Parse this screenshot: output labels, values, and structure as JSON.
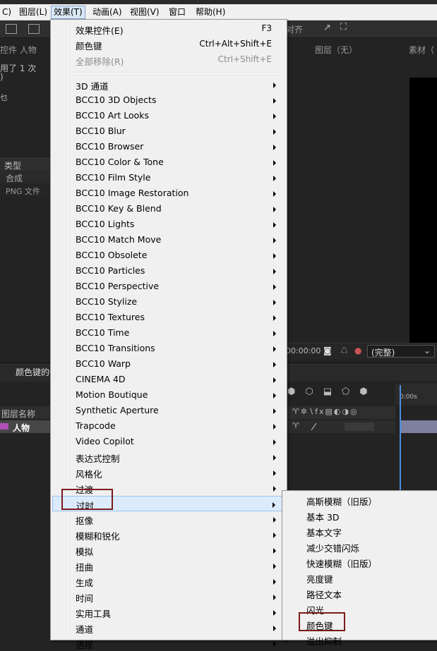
{
  "menubar": {
    "items": [
      {
        "label": "C)"
      },
      {
        "label": "图层(L)"
      },
      {
        "label": "效果(T)"
      },
      {
        "label": "动画(A)"
      },
      {
        "label": "视图(V)"
      },
      {
        "label": "窗口"
      },
      {
        "label": "帮助(H)"
      }
    ]
  },
  "toolbar": {
    "align_label": "对齐"
  },
  "project_panel": {
    "tab_label": "控件 人物",
    "used_text": "用了 1 次",
    "paren_text": ")",
    "small_text": "乜",
    "type_header": "类型",
    "rows": [
      "合成",
      "PNG 文件"
    ]
  },
  "composition": {
    "tab_label": "图层（无）",
    "footage_label": "素材（",
    "timecode": "00:00:00",
    "quality": "(完整)",
    "frame_label": "0:00s"
  },
  "timeline": {
    "comp_tab": "颜色键的使",
    "layer_name_header": "图层名称",
    "layer_name": "人物"
  },
  "effects_menu": {
    "items": [
      {
        "label": "效果控件(E)",
        "shortcut": "F3",
        "arrow": false,
        "disabled": false
      },
      {
        "label": "颜色键",
        "shortcut": "Ctrl+Alt+Shift+E",
        "arrow": false,
        "disabled": false
      },
      {
        "label": "全部移除(R)",
        "shortcut": "Ctrl+Shift+E",
        "arrow": false,
        "disabled": true
      },
      {
        "label": "3D 通道",
        "shortcut": "",
        "arrow": true
      },
      {
        "label": "BCC10 3D Objects",
        "shortcut": "",
        "arrow": true
      },
      {
        "label": "BCC10 Art Looks",
        "shortcut": "",
        "arrow": true
      },
      {
        "label": "BCC10 Blur",
        "shortcut": "",
        "arrow": true
      },
      {
        "label": "BCC10 Browser",
        "shortcut": "",
        "arrow": true
      },
      {
        "label": "BCC10 Color & Tone",
        "shortcut": "",
        "arrow": true
      },
      {
        "label": "BCC10 Film Style",
        "shortcut": "",
        "arrow": true
      },
      {
        "label": "BCC10 Image Restoration",
        "shortcut": "",
        "arrow": true
      },
      {
        "label": "BCC10 Key & Blend",
        "shortcut": "",
        "arrow": true
      },
      {
        "label": "BCC10 Lights",
        "shortcut": "",
        "arrow": true
      },
      {
        "label": "BCC10 Match Move",
        "shortcut": "",
        "arrow": true
      },
      {
        "label": "BCC10 Obsolete",
        "shortcut": "",
        "arrow": true
      },
      {
        "label": "BCC10 Particles",
        "shortcut": "",
        "arrow": true
      },
      {
        "label": "BCC10 Perspective",
        "shortcut": "",
        "arrow": true
      },
      {
        "label": "BCC10 Stylize",
        "shortcut": "",
        "arrow": true
      },
      {
        "label": "BCC10 Textures",
        "shortcut": "",
        "arrow": true
      },
      {
        "label": "BCC10 Time",
        "shortcut": "",
        "arrow": true
      },
      {
        "label": "BCC10 Transitions",
        "shortcut": "",
        "arrow": true
      },
      {
        "label": "BCC10 Warp",
        "shortcut": "",
        "arrow": true
      },
      {
        "label": "CINEMA 4D",
        "shortcut": "",
        "arrow": true
      },
      {
        "label": "Motion Boutique",
        "shortcut": "",
        "arrow": true
      },
      {
        "label": "Synthetic Aperture",
        "shortcut": "",
        "arrow": true
      },
      {
        "label": "Trapcode",
        "shortcut": "",
        "arrow": true
      },
      {
        "label": "Video Copilot",
        "shortcut": "",
        "arrow": true
      },
      {
        "label": "表达式控制",
        "shortcut": "",
        "arrow": true
      },
      {
        "label": "风格化",
        "shortcut": "",
        "arrow": true
      },
      {
        "label": "过渡",
        "shortcut": "",
        "arrow": true
      },
      {
        "label": "过时",
        "shortcut": "",
        "arrow": true,
        "highlighted": true
      },
      {
        "label": "抠像",
        "shortcut": "",
        "arrow": true
      },
      {
        "label": "模糊和锐化",
        "shortcut": "",
        "arrow": true
      },
      {
        "label": "模拟",
        "shortcut": "",
        "arrow": true
      },
      {
        "label": "扭曲",
        "shortcut": "",
        "arrow": true
      },
      {
        "label": "生成",
        "shortcut": "",
        "arrow": true
      },
      {
        "label": "时间",
        "shortcut": "",
        "arrow": true
      },
      {
        "label": "实用工具",
        "shortcut": "",
        "arrow": true
      },
      {
        "label": "通道",
        "shortcut": "",
        "arrow": true
      },
      {
        "label": "透视",
        "shortcut": "",
        "arrow": true
      }
    ]
  },
  "obsolete_submenu": {
    "items": [
      {
        "label": "高斯模糊（旧版）"
      },
      {
        "label": "基本 3D"
      },
      {
        "label": "基本文字"
      },
      {
        "label": "减少交错闪烁"
      },
      {
        "label": "快速模糊（旧版）"
      },
      {
        "label": "亮度键"
      },
      {
        "label": "路径文本"
      },
      {
        "label": "闪光"
      },
      {
        "label": "颜色键"
      },
      {
        "label": "溢出抑制"
      }
    ]
  },
  "colors": {
    "menu_bg": "#f0f0f0",
    "highlight": "#dcebfc",
    "annotation_box": "#7a1b1b",
    "panel_bg": "#232323"
  }
}
